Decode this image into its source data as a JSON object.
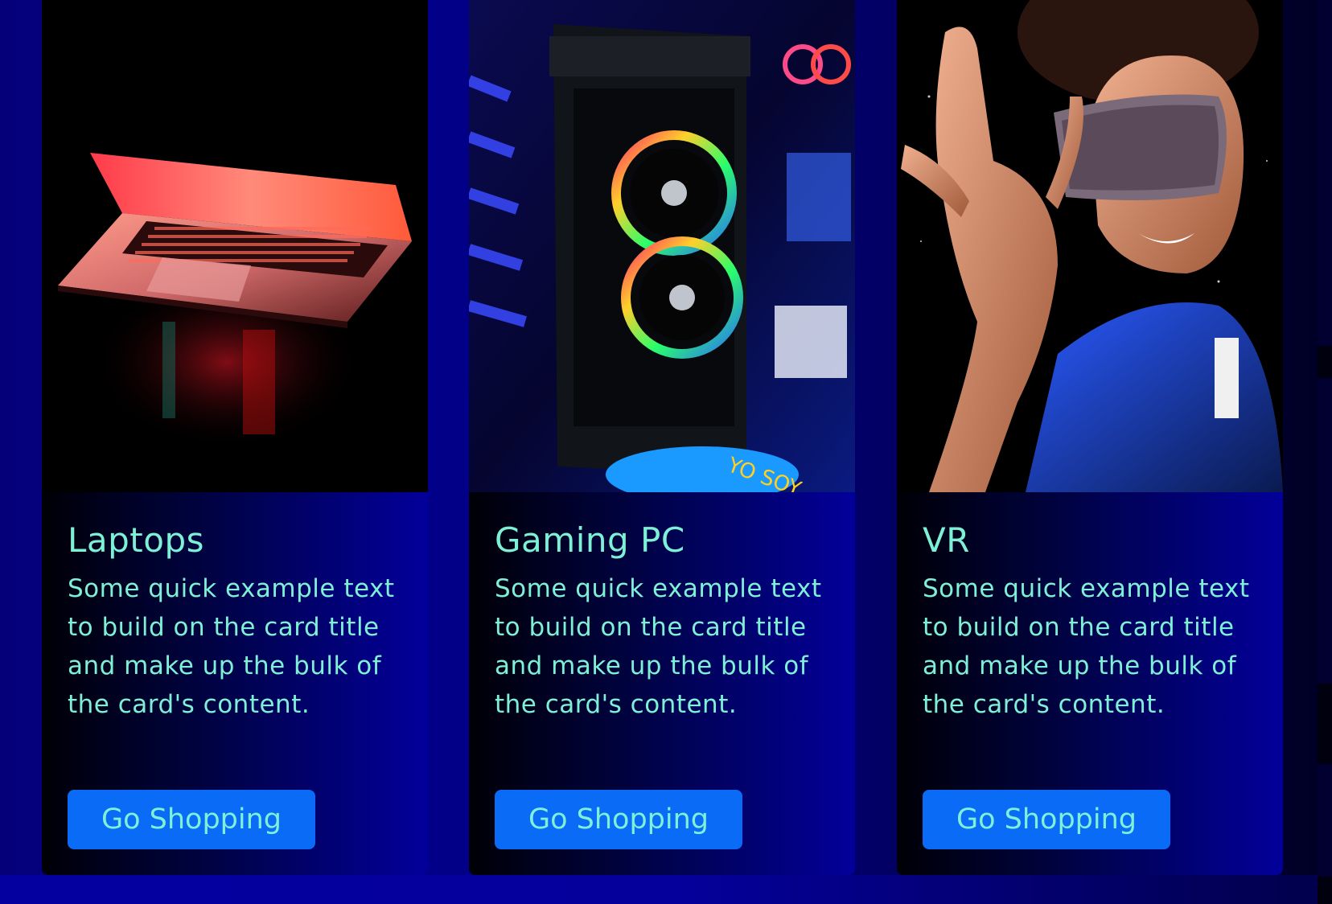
{
  "colors": {
    "card_text": "#7ef0d6",
    "button_bg": "#0a6cf6",
    "page_bg": "#02008a"
  },
  "cards": [
    {
      "title": "Laptops",
      "text": "Some quick example text to build on the card title and make up the bulk of the card's content.",
      "button_label": "Go Shopping",
      "image_icon": "laptop-photo"
    },
    {
      "title": "Gaming PC",
      "text": "Some quick example text to build on the card title and make up the bulk of the card's content.",
      "button_label": "Go Shopping",
      "image_icon": "gaming-pc-photo"
    },
    {
      "title": "VR",
      "text": "Some quick example text to build on the card title and make up the bulk of the card's content.",
      "button_label": "Go Shopping",
      "image_icon": "vr-headset-photo"
    }
  ]
}
